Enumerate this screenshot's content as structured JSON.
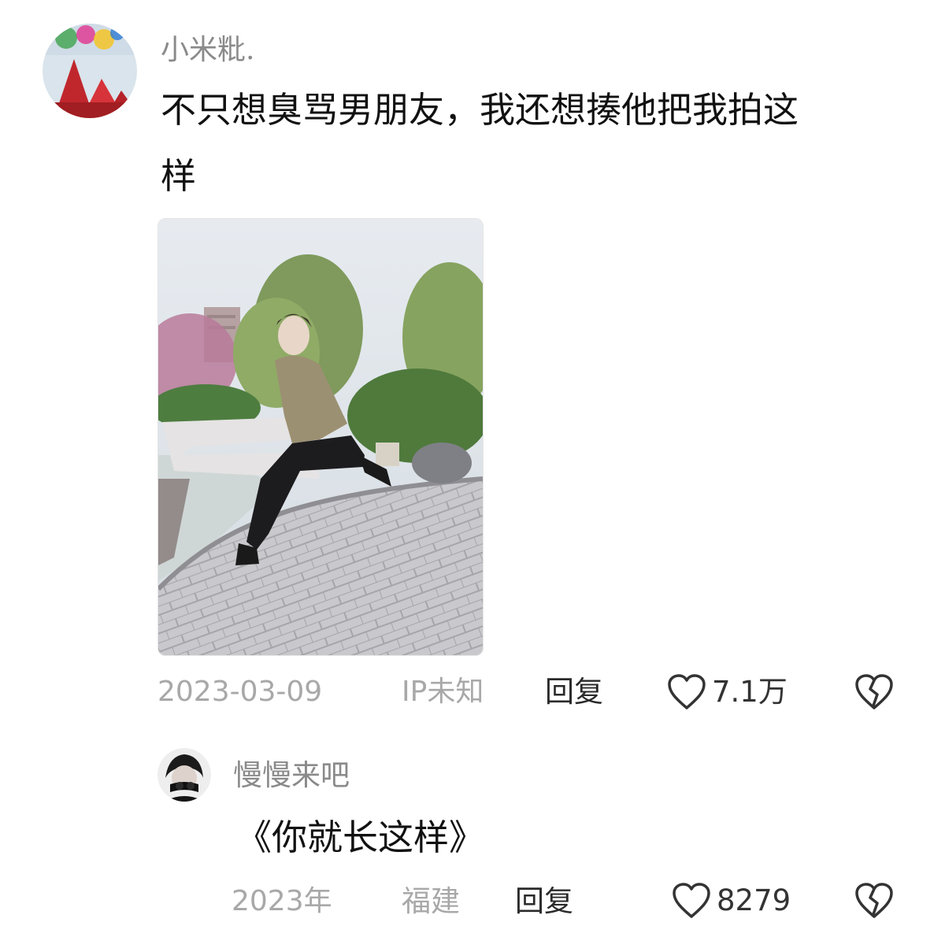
{
  "comment": {
    "username": "小米粃.",
    "text_line1": "不只想臭骂男朋友，我还想揍他把我拍这",
    "text_line2": "样",
    "date": "2023-03-09",
    "ip": "IP未知",
    "reply_label": "回复",
    "likes": "7.1万"
  },
  "reply": {
    "username": "慢慢来吧",
    "text": "《你就长这样》",
    "date": "2023年",
    "location": "福建",
    "reply_label": "回复",
    "likes": "8279"
  },
  "icons": {
    "like": "heart-outline-icon",
    "dislike": "broken-heart-icon"
  }
}
